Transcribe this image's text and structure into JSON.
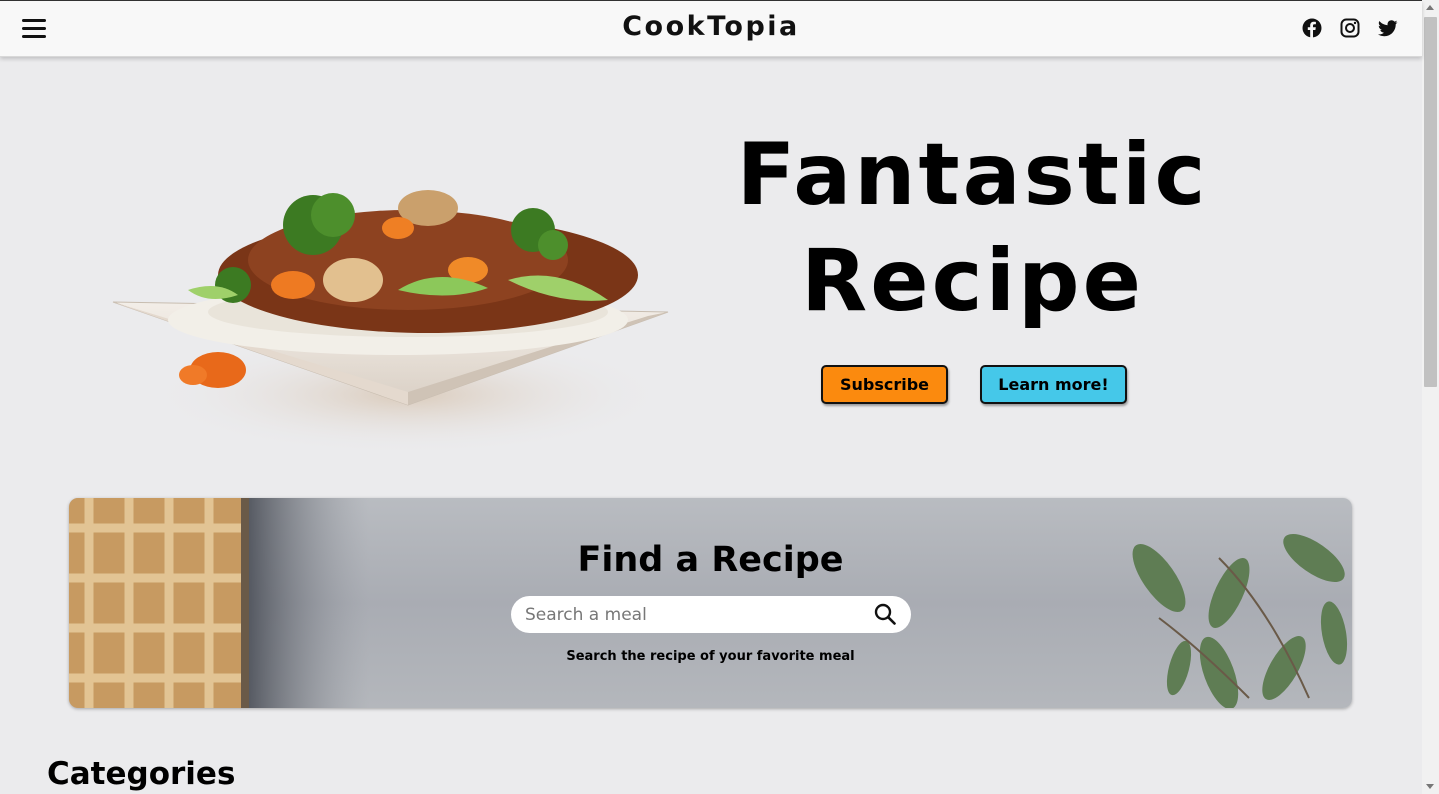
{
  "header": {
    "brand": "CookTopia",
    "menu_icon": "hamburger-menu-icon",
    "socials": [
      "facebook-icon",
      "instagram-icon",
      "twitter-icon"
    ]
  },
  "hero": {
    "title_line1": "Fantastic",
    "title_line2": "Recipe",
    "subscribe_label": "Subscribe",
    "learn_more_label": "Learn more!",
    "subscribe_color": "#fb8a0e",
    "learn_more_color": "#45c8e9"
  },
  "search": {
    "title": "Find a Recipe",
    "placeholder": "Search a meal",
    "subtitle": "Search the recipe of your favorite meal"
  },
  "categories": {
    "title": "Categories"
  }
}
